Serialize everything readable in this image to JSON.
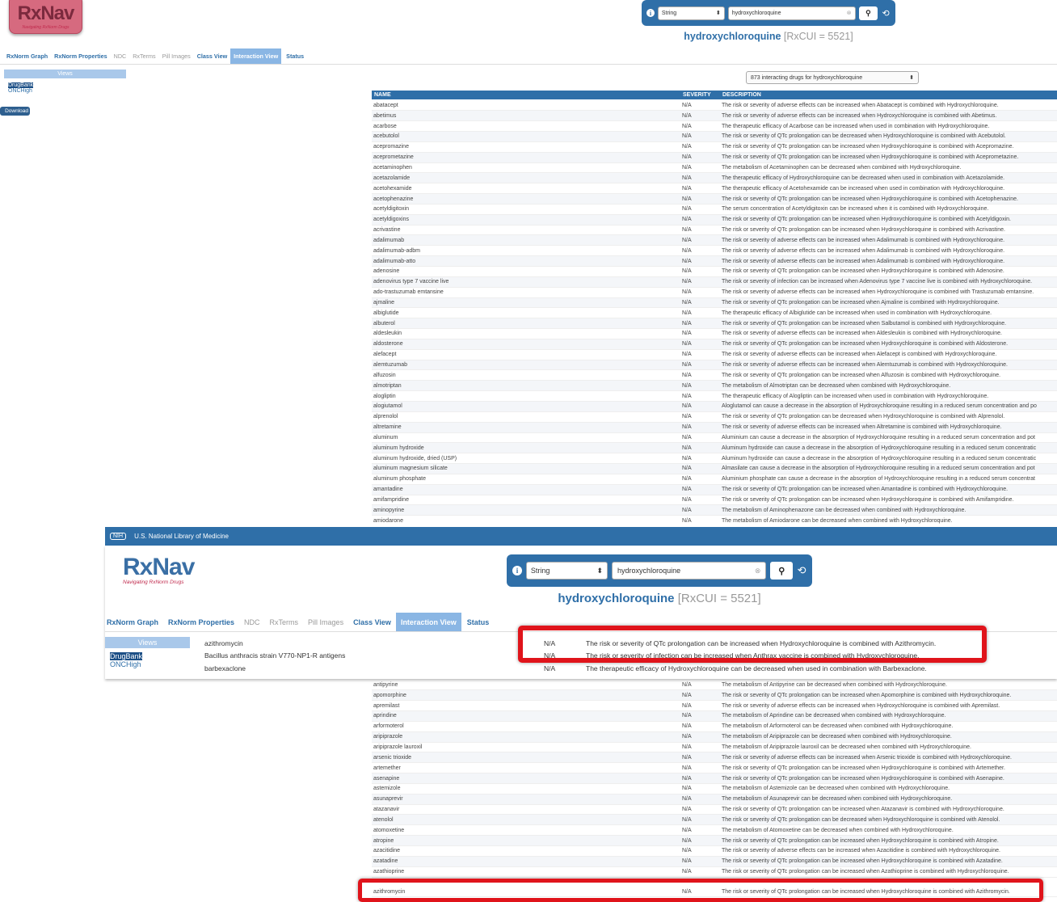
{
  "app": {
    "logo_text": "RxNav",
    "logo_sub": "Navigating RxNorm Drugs",
    "nih_label": "NIH",
    "nlm": "U.S. National Library of Medicine"
  },
  "search": {
    "type": "String",
    "query": "hydroxychloroquine"
  },
  "drug": {
    "name": "hydroxychloroquine",
    "rxcui": "[RxCUI = 5521]"
  },
  "tabs": [
    "RxNorm Graph",
    "RxNorm Properties",
    "NDC",
    "RxTerms",
    "Pill Images",
    "Class View",
    "Interaction View",
    "Status"
  ],
  "views": {
    "header": "Views",
    "items": [
      "DrugBank",
      "ONCHigh"
    ],
    "download": "Download"
  },
  "count_label": "873 interacting drugs for hydroxychloroquine",
  "columns": {
    "name": "NAME",
    "severity": "SEVERITY",
    "description": "DESCRIPTION"
  },
  "rows_top": [
    [
      "abatacept",
      "N/A",
      "The risk or severity of adverse effects can be increased when Abatacept is combined with Hydroxychloroquine."
    ],
    [
      "abetimus",
      "N/A",
      "The risk or severity of adverse effects can be increased when Hydroxychloroquine is combined with Abetimus."
    ],
    [
      "acarbose",
      "N/A",
      "The therapeutic efficacy of Acarbose can be increased when used in combination with Hydroxychloroquine."
    ],
    [
      "acebutolol",
      "N/A",
      "The risk or severity of QTc prolongation can be decreased when Hydroxychloroquine is combined with Acebutolol."
    ],
    [
      "acepromazine",
      "N/A",
      "The risk or severity of QTc prolongation can be increased when Hydroxychloroquine is combined with Acepromazine."
    ],
    [
      "aceprometazine",
      "N/A",
      "The risk or severity of QTc prolongation can be increased when Hydroxychloroquine is combined with Aceprometazine."
    ],
    [
      "acetaminophen",
      "N/A",
      "The metabolism of Acetaminophen can be decreased when combined with Hydroxychloroquine."
    ],
    [
      "acetazolamide",
      "N/A",
      "The therapeutic efficacy of Hydroxychloroquine can be decreased when used in combination with Acetazolamide."
    ],
    [
      "acetohexamide",
      "N/A",
      "The therapeutic efficacy of Acetohexamide can be increased when used in combination with Hydroxychloroquine."
    ],
    [
      "acetophenazine",
      "N/A",
      "The risk or severity of QTc prolongation can be increased when Hydroxychloroquine is combined with Acetophenazine."
    ],
    [
      "acetyldigitoxin",
      "N/A",
      "The serum concentration of Acetyldigitoxin can be increased when it is combined with Hydroxychloroquine."
    ],
    [
      "acetyldigoxins",
      "N/A",
      "The risk or severity of QTc prolongation can be increased when Hydroxychloroquine is combined with Acetyldigoxin."
    ],
    [
      "acrivastine",
      "N/A",
      "The risk or severity of QTc prolongation can be increased when Hydroxychloroquine is combined with Acrivastine."
    ],
    [
      "adalimumab",
      "N/A",
      "The risk or severity of adverse effects can be increased when Adalimumab is combined with Hydroxychloroquine."
    ],
    [
      "adalimumab-adbm",
      "N/A",
      "The risk or severity of adverse effects can be increased when Adalimumab is combined with Hydroxychloroquine."
    ],
    [
      "adalimumab-atto",
      "N/A",
      "The risk or severity of adverse effects can be increased when Adalimumab is combined with Hydroxychloroquine."
    ],
    [
      "adenosine",
      "N/A",
      "The risk or severity of QTc prolongation can be increased when Hydroxychloroquine is combined with Adenosine."
    ],
    [
      "adenovirus type 7 vaccine live",
      "N/A",
      "The risk or severity of infection can be increased when Adenovirus type 7 vaccine live is combined with Hydroxychloroquine."
    ],
    [
      "ado-trastuzumab emtansine",
      "N/A",
      "The risk or severity of adverse effects can be increased when Hydroxychloroquine is combined with Trastuzumab emtansine."
    ],
    [
      "ajmaline",
      "N/A",
      "The risk or severity of QTc prolongation can be increased when Ajmaline is combined with Hydroxychloroquine."
    ],
    [
      "albiglutide",
      "N/A",
      "The therapeutic efficacy of Albiglutide can be increased when used in combination with Hydroxychloroquine."
    ],
    [
      "albuterol",
      "N/A",
      "The risk or severity of QTc prolongation can be increased when Salbutamol is combined with Hydroxychloroquine."
    ],
    [
      "aldesleukin",
      "N/A",
      "The risk or severity of adverse effects can be increased when Aldesleukin is combined with Hydroxychloroquine."
    ],
    [
      "aldosterone",
      "N/A",
      "The risk or severity of QTc prolongation can be increased when Hydroxychloroquine is combined with Aldosterone."
    ],
    [
      "alefacept",
      "N/A",
      "The risk or severity of adverse effects can be increased when Alefacept is combined with Hydroxychloroquine."
    ],
    [
      "alemtuzumab",
      "N/A",
      "The risk or severity of adverse effects can be increased when Alemtuzumab is combined with Hydroxychloroquine."
    ],
    [
      "alfuzosin",
      "N/A",
      "The risk or severity of QTc prolongation can be increased when Alfuzosin is combined with Hydroxychloroquine."
    ],
    [
      "almotriptan",
      "N/A",
      "The metabolism of Almotriptan can be decreased when combined with Hydroxychloroquine."
    ],
    [
      "alogliptin",
      "N/A",
      "The therapeutic efficacy of Alogliptin can be increased when used in combination with Hydroxychloroquine."
    ],
    [
      "alogiutamol",
      "N/A",
      "Aloglutamol can cause a decrease in the absorption of Hydroxychloroquine resulting in a reduced serum concentration and po"
    ],
    [
      "alprenolol",
      "N/A",
      "The risk or severity of QTc prolongation can be decreased when Hydroxychloroquine is combined with Alprenolol."
    ],
    [
      "altretamine",
      "N/A",
      "The risk or severity of adverse effects can be increased when Altretamine is combined with Hydroxychloroquine."
    ],
    [
      "aluminum",
      "N/A",
      "Aluminium can cause a decrease in the absorption of Hydroxychloroquine resulting in a reduced serum concentration and pot"
    ],
    [
      "aluminum hydroxide",
      "N/A",
      "Aluminum hydroxide can cause a decrease in the absorption of Hydroxychloroquine resulting in a reduced serum concentratic"
    ],
    [
      "aluminum hydroxide, dried (USP)",
      "N/A",
      "Aluminum hydroxide can cause a decrease in the absorption of Hydroxychloroquine resulting in a reduced serum concentratic"
    ],
    [
      "aluminum magnesium silicate",
      "N/A",
      "Almasilate can cause a decrease in the absorption of Hydroxychloroquine resulting in a reduced serum concentration and pot"
    ],
    [
      "aluminum phosphate",
      "N/A",
      "Aluminium phosphate can cause a decrease in the absorption of Hydroxychloroquine resulting in a reduced serum concentrat"
    ],
    [
      "amantadine",
      "N/A",
      "The risk or severity of QTc prolongation can be increased when Amantadine is combined with Hydroxychloroquine."
    ],
    [
      "amifampridine",
      "N/A",
      "The risk or severity of QTc prolongation can be increased when Hydroxychloroquine is combined with Amifampridine."
    ],
    [
      "aminopyrine",
      "N/A",
      "The metabolism of Aminophenazone can be decreased when combined with Hydroxychloroquine."
    ],
    [
      "amiodarone",
      "N/A",
      "The metabolism of Amiodarone can be decreased when combined with Hydroxychloroquine."
    ]
  ],
  "rows_bottom": [
    [
      "antipyrine",
      "N/A",
      "The metabolism of Antipyrine can be decreased when combined with Hydroxychloroquine."
    ],
    [
      "apomorphine",
      "N/A",
      "The risk or severity of QTc prolongation can be increased when Apomorphine is combined with Hydroxychloroquine."
    ],
    [
      "apremilast",
      "N/A",
      "The risk or severity of adverse effects can be increased when Hydroxychloroquine is combined with Apremilast."
    ],
    [
      "aprindine",
      "N/A",
      "The metabolism of Aprindine can be decreased when combined with Hydroxychloroquine."
    ],
    [
      "arformoterol",
      "N/A",
      "The metabolism of Arformoterol can be decreased when combined with Hydroxychloroquine."
    ],
    [
      "aripiprazole",
      "N/A",
      "The metabolism of Aripiprazole can be decreased when combined with Hydroxychloroquine."
    ],
    [
      "aripiprazole lauroxil",
      "N/A",
      "The metabolism of Aripiprazole lauroxil can be decreased when combined with Hydroxychloroquine."
    ],
    [
      "arsenic trioxide",
      "N/A",
      "The risk or severity of adverse effects can be increased when Arsenic trioxide is combined with Hydroxychloroquine."
    ],
    [
      "artemether",
      "N/A",
      "The risk or severity of QTc prolongation can be increased when Hydroxychloroquine is combined with Artemether."
    ],
    [
      "asenapine",
      "N/A",
      "The risk or severity of QTc prolongation can be increased when Hydroxychloroquine is combined with Asenapine."
    ],
    [
      "astemizole",
      "N/A",
      "The metabolism of Astemizole can be decreased when combined with Hydroxychloroquine."
    ],
    [
      "asunaprevir",
      "N/A",
      "The metabolism of Asunaprevir can be decreased when combined with Hydroxychloroquine."
    ],
    [
      "atazanavir",
      "N/A",
      "The risk or severity of QTc prolongation can be increased when Atazanavir is combined with Hydroxychloroquine."
    ],
    [
      "atenolol",
      "N/A",
      "The risk or severity of QTc prolongation can be decreased when Hydroxychloroquine is combined with Atenolol."
    ],
    [
      "atomoxetine",
      "N/A",
      "The metabolism of Atomoxetine can be decreased when combined with Hydroxychloroquine."
    ],
    [
      "atropine",
      "N/A",
      "The risk or severity of QTc prolongation can be increased when Hydroxychloroquine is combined with Atropine."
    ],
    [
      "azacitidine",
      "N/A",
      "The risk or severity of adverse effects can be increased when Azacitidine is combined with Hydroxychloroquine."
    ],
    [
      "azatadine",
      "N/A",
      "The risk or severity of QTc prolongation can be increased when Hydroxychloroquine is combined with Azatadine."
    ],
    [
      "azathioprine",
      "N/A",
      "The risk or severity of QTc prolongation can be increased when Azathioprine is combined with Hydroxychloroquine."
    ]
  ],
  "last_row": [
    "azithromycin",
    "N/A",
    "The risk or severity of QTc prolongation can be increased when Hydroxychloroquine is combined with Azithromycin."
  ],
  "zoom_rows": [
    [
      "azithromycin",
      "N/A",
      "The risk or severity of QTc prolongation can be increased when Hydroxychloroquine is combined with Azithromycin."
    ],
    [
      "Bacillus anthracis strain V770-NP1-R antigens",
      "N/A",
      "The risk or severity of infection can be increased when Anthrax vaccine is combined with Hydroxychloroquine."
    ],
    [
      "barbexaclone",
      "N/A",
      "The therapeutic efficacy of Hydroxychloroquine can be decreased when used in combination with Barbexaclone."
    ]
  ]
}
